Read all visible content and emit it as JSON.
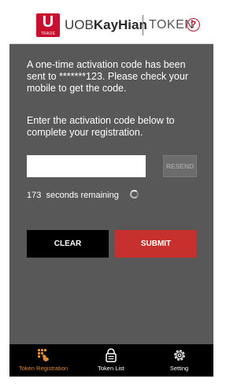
{
  "header": {
    "logo_mark": "U",
    "logo_sub": "TRADE",
    "brand_prefix": "UOB",
    "brand_name": "KayHian",
    "section": "TOKEN",
    "help_glyph": "?"
  },
  "activation": {
    "sent_message": "A one-time activation code has been sent to *******123. Please check your mobile to get the code.",
    "instruction": "Enter the activation code below to complete your registration.",
    "code_value": "",
    "resend_label": "RESEND",
    "seconds_remaining": "173",
    "seconds_label": "seconds remaining"
  },
  "actions": {
    "clear_label": "CLEAR",
    "submit_label": "SUBMIT"
  },
  "tabs": [
    {
      "label": "Token Registration",
      "icon": "keypad-hand-icon",
      "active": true
    },
    {
      "label": "Token List",
      "icon": "lock-list-icon",
      "active": false
    },
    {
      "label": "Setting",
      "icon": "gear-icon",
      "active": false
    }
  ],
  "colors": {
    "brand_red": "#c8102e",
    "submit_red": "#c8302e",
    "background_gray": "#585858",
    "active_tab": "#e28a35"
  }
}
